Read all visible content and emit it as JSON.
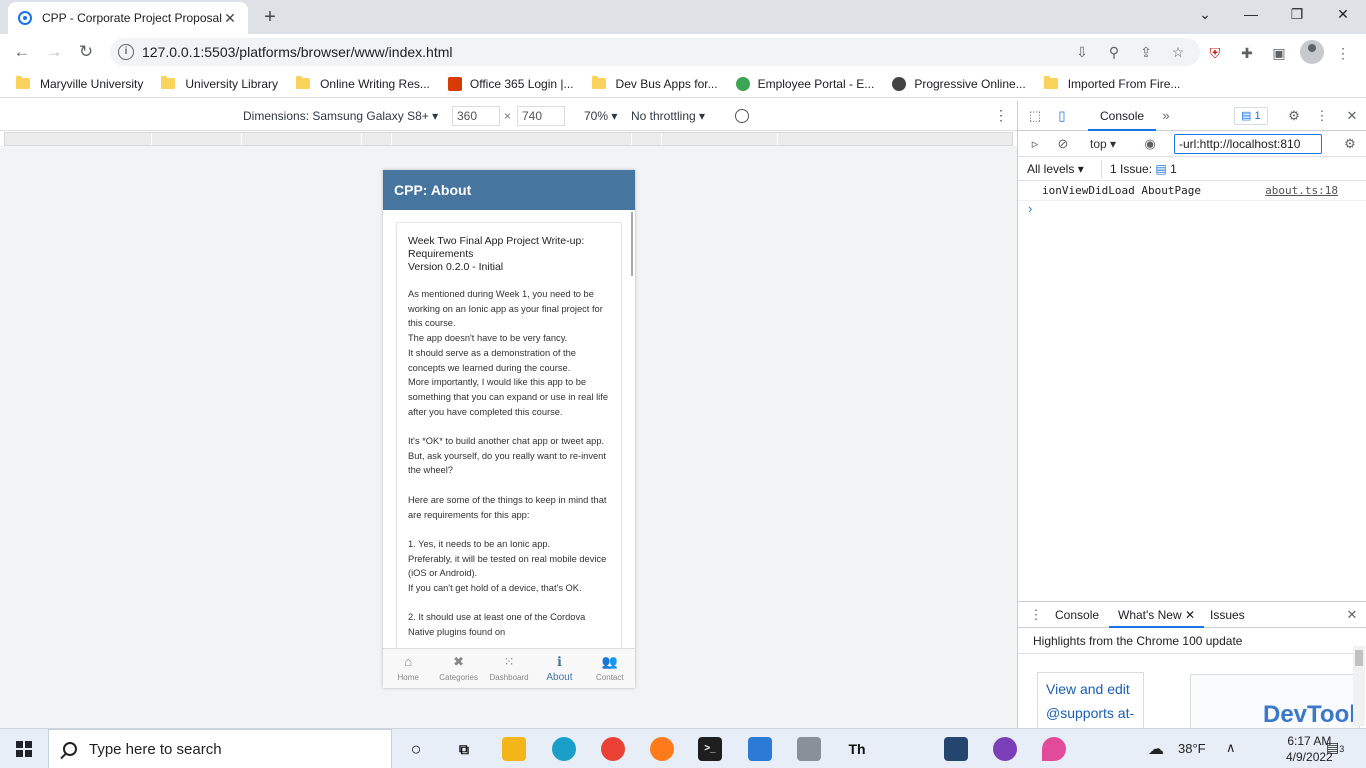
{
  "browser": {
    "tab_title": "CPP - Corporate Project Proposal",
    "url": "127.0.0.1:5503/platforms/browser/www/index.html",
    "bookmarks": [
      {
        "label": "Maryville University",
        "icon": "folder-icon"
      },
      {
        "label": "University Library",
        "icon": "folder-icon"
      },
      {
        "label": "Online Writing Res...",
        "icon": "folder-icon"
      },
      {
        "label": "Office 365 Login |...",
        "icon": "office-icon"
      },
      {
        "label": "Dev Bus Apps for...",
        "icon": "folder-icon"
      },
      {
        "label": "Employee Portal - E...",
        "icon": "portal-icon"
      },
      {
        "label": "Progressive Online...",
        "icon": "globe-icon"
      },
      {
        "label": "Imported From Fire...",
        "icon": "folder-icon"
      }
    ]
  },
  "device_toolbar": {
    "dimensions_label": "Dimensions: Samsung Galaxy S8+",
    "width": "360",
    "times": "×",
    "height": "740",
    "zoom": "70%",
    "throttling": "No throttling"
  },
  "app": {
    "header_title": "CPP: About",
    "card_title": "Week Two Final App Project Write-up:\nRequirements\nVersion 0.2.0 - Initial",
    "card_body": "As mentioned during Week 1, you need to be working on an Ionic app as your final project for this course.\nThe app doesn't have to be very fancy.\nIt should serve as a demonstration of the concepts we learned during the course.\nMore importantly, I would like this app to be something that you can expand or use in real life after you have completed this course.\n\nIt's *OK* to build another chat app or tweet app. But, ask yourself, do you really want to re-invent the wheel?\n\nHere are some of the things to keep in mind that are requirements for this app:\n\n1. Yes, it needs to be an Ionic app.\nPreferably, it will be tested on real mobile device (iOS or Android).\nIf you can't get hold of a device, that's OK.\n\n2. It should use at least one of the Cordova Native plugins found on",
    "tabs": [
      {
        "label": "Home",
        "icon": "home-icon",
        "glyph": "⌂"
      },
      {
        "label": "Categories",
        "icon": "tools-icon",
        "glyph": "✖"
      },
      {
        "label": "Dashboard",
        "icon": "grid-icon",
        "glyph": "⁙"
      },
      {
        "label": "About",
        "icon": "info-icon",
        "glyph": "ℹ"
      },
      {
        "label": "Contact",
        "icon": "contacts-icon",
        "glyph": "👥"
      }
    ]
  },
  "devtools": {
    "console_tab": "Console",
    "badge_count": "1",
    "context": "top",
    "filter_value": "-url:http://localhost:810",
    "levels": "All levels",
    "issues": "1 Issue:",
    "issues_count": "1",
    "log_message": "ionViewDidLoad AboutPage",
    "log_source": "about.ts:18",
    "drawer_tabs": [
      "Console",
      "What's New",
      "Issues"
    ],
    "highlights": "Highlights from the Chrome 100 update",
    "whats_new_card": "View and edit @supports at-rules",
    "whats_new_image": "DevTools"
  },
  "taskbar": {
    "search_placeholder": "Type here to search",
    "weather": "38°F",
    "time": "6:17 AM",
    "date": "4/9/2022",
    "notifications": "3"
  }
}
